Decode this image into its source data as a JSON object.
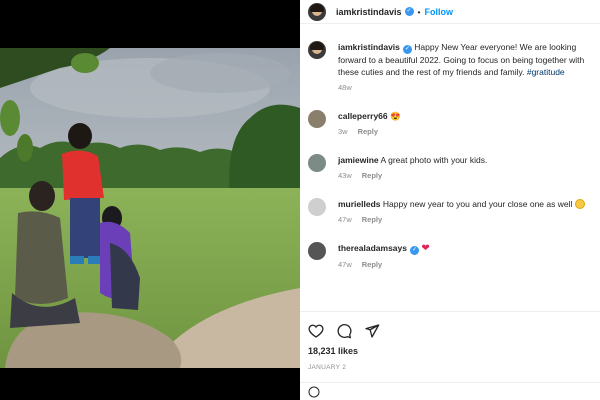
{
  "post": {
    "username": "iamkristindavis",
    "follow_label": "Follow",
    "separator": "•"
  },
  "caption": {
    "username": "iamkristindavis",
    "text": "Happy New Year everyone! We are looking forward to a beautiful 2022. Going to focus on being together with these cuties and the rest of my friends and family.",
    "hashtag": "#gratitude",
    "time": "48w"
  },
  "comments": [
    {
      "username": "calleperry66",
      "text": "",
      "emoji": "heart-eyes",
      "time": "3w",
      "reply": "Reply"
    },
    {
      "username": "jamiewine",
      "text": "A great photo with your kids.",
      "time": "43w",
      "reply": "Reply"
    },
    {
      "username": "murielleds",
      "text": "Happy new year to you and your close one as well",
      "emoji": "smile",
      "time": "47w",
      "reply": "Reply"
    },
    {
      "username": "therealadamsays",
      "text": "",
      "emoji": "red-heart",
      "time": "47w",
      "reply": "Reply"
    }
  ],
  "footer": {
    "likes": "18,231 likes",
    "date": "JANUARY 2"
  },
  "colors": {
    "link": "#0095f6",
    "verified": "#3897f0",
    "muted": "#8e8e8e"
  }
}
